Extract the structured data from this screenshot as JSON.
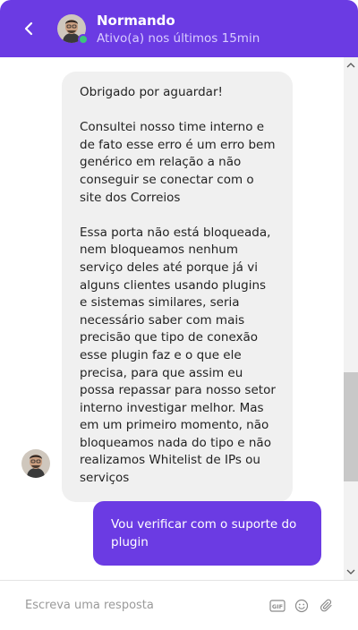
{
  "header": {
    "agent_name": "Normando",
    "agent_status": "Ativo(a) nos últimos 15min"
  },
  "messages": [
    {
      "from": "agent",
      "paragraphs": [
        "Obrigado por aguardar!",
        "Consultei nosso time interno e de fato esse erro é um erro bem genérico em relação a não conseguir se conectar com o site dos Correios",
        "Essa porta não está bloqueada, nem bloqueamos nenhum serviço deles até porque já vi alguns clientes usando plugins e sistemas similares, seria necessário saber com mais precisão que tipo de conexão esse plugin faz e o que ele precisa, para que assim eu possa repassar para nosso setor interno investigar melhor. Mas em um primeiro momento, não bloqueamos nada do tipo e não realizamos Whitelist de IPs ou serviços"
      ]
    },
    {
      "from": "user",
      "text": "Vou verificar com o suporte do plugin"
    }
  ],
  "composer": {
    "placeholder": "Escreva uma resposta",
    "gif_label": "GIF"
  },
  "colors": {
    "brand": "#6b3be3",
    "online": "#3cc47c",
    "agent_bubble": "#f0f0f0"
  },
  "icons": [
    "back-arrow-icon",
    "online-status-icon",
    "scroll-up-icon",
    "scroll-down-icon",
    "gif-icon",
    "emoji-icon",
    "attachment-icon"
  ]
}
